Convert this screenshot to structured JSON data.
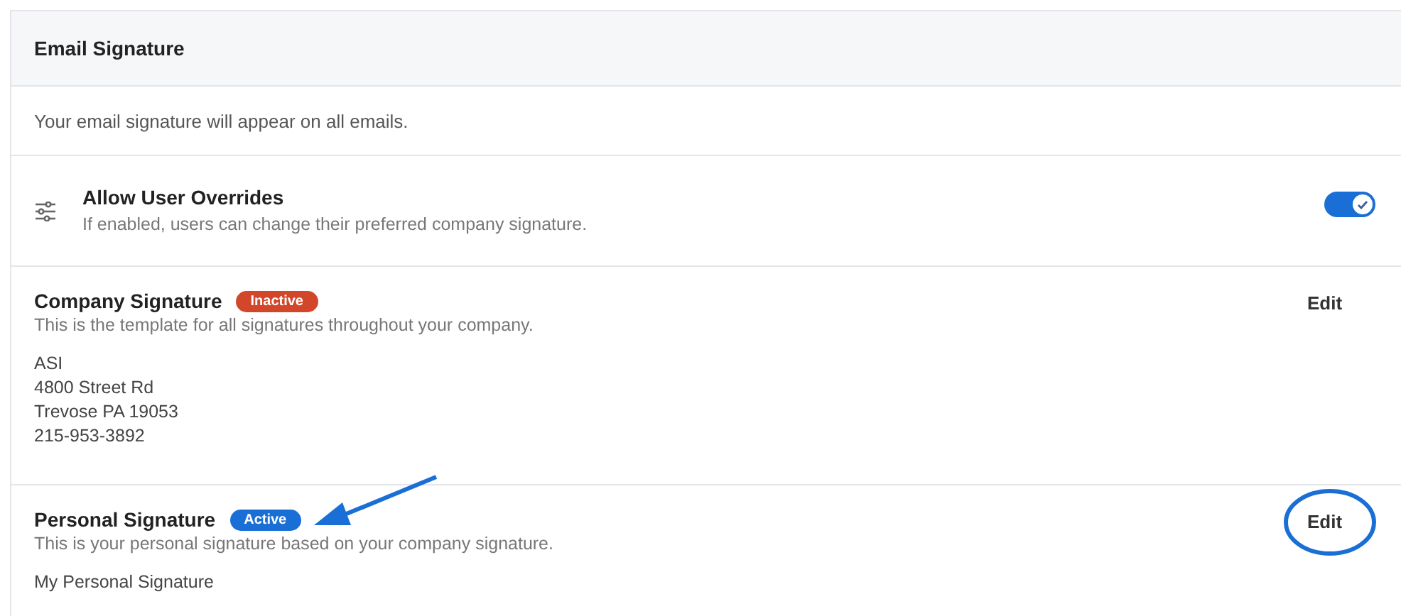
{
  "card": {
    "title": "Email Signature",
    "description": "Your email signature will appear on all emails."
  },
  "override": {
    "title": "Allow User Overrides",
    "hint": "If enabled, users can change their preferred company signature.",
    "on": true
  },
  "signatures": [
    {
      "title": "Company Signature",
      "status": "Inactive",
      "active": false,
      "hint": "This is the template for all signatures throughout your company.",
      "lines": [
        "ASI",
        "4800 Street Rd",
        "Trevose PA 19053",
        "215-953-3892"
      ],
      "action": "Edit",
      "circled": false,
      "arrow": false
    },
    {
      "title": "Personal Signature",
      "status": "Active",
      "active": true,
      "hint": "This is your personal signature based on your company signature.",
      "lines": [
        "My Personal Signature"
      ],
      "action": "Edit",
      "circled": true,
      "arrow": true
    }
  ]
}
